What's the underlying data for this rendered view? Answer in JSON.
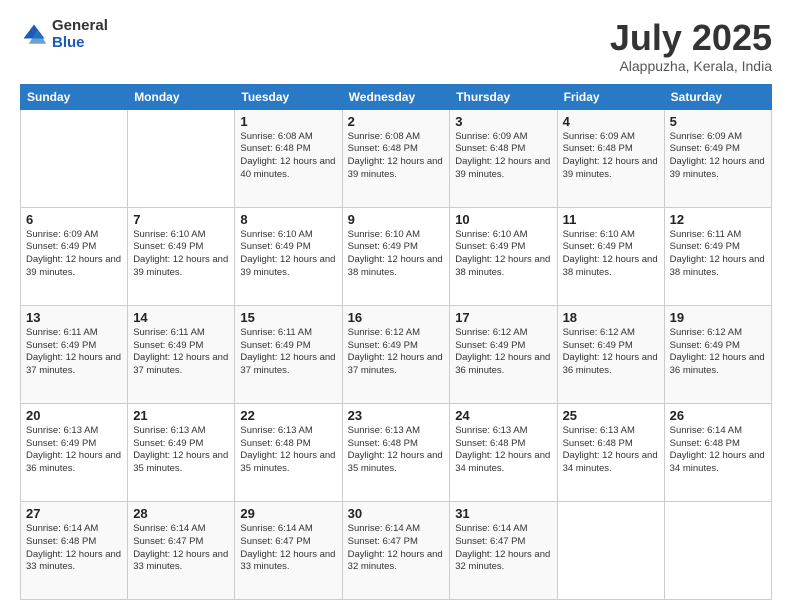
{
  "logo": {
    "general": "General",
    "blue": "Blue"
  },
  "header": {
    "month": "July 2025",
    "location": "Alappuzha, Kerala, India"
  },
  "weekdays": [
    "Sunday",
    "Monday",
    "Tuesday",
    "Wednesday",
    "Thursday",
    "Friday",
    "Saturday"
  ],
  "weeks": [
    [
      {
        "day": "",
        "info": ""
      },
      {
        "day": "",
        "info": ""
      },
      {
        "day": "1",
        "info": "Sunrise: 6:08 AM\nSunset: 6:48 PM\nDaylight: 12 hours and 40 minutes."
      },
      {
        "day": "2",
        "info": "Sunrise: 6:08 AM\nSunset: 6:48 PM\nDaylight: 12 hours and 39 minutes."
      },
      {
        "day": "3",
        "info": "Sunrise: 6:09 AM\nSunset: 6:48 PM\nDaylight: 12 hours and 39 minutes."
      },
      {
        "day": "4",
        "info": "Sunrise: 6:09 AM\nSunset: 6:48 PM\nDaylight: 12 hours and 39 minutes."
      },
      {
        "day": "5",
        "info": "Sunrise: 6:09 AM\nSunset: 6:49 PM\nDaylight: 12 hours and 39 minutes."
      }
    ],
    [
      {
        "day": "6",
        "info": "Sunrise: 6:09 AM\nSunset: 6:49 PM\nDaylight: 12 hours and 39 minutes."
      },
      {
        "day": "7",
        "info": "Sunrise: 6:10 AM\nSunset: 6:49 PM\nDaylight: 12 hours and 39 minutes."
      },
      {
        "day": "8",
        "info": "Sunrise: 6:10 AM\nSunset: 6:49 PM\nDaylight: 12 hours and 39 minutes."
      },
      {
        "day": "9",
        "info": "Sunrise: 6:10 AM\nSunset: 6:49 PM\nDaylight: 12 hours and 38 minutes."
      },
      {
        "day": "10",
        "info": "Sunrise: 6:10 AM\nSunset: 6:49 PM\nDaylight: 12 hours and 38 minutes."
      },
      {
        "day": "11",
        "info": "Sunrise: 6:10 AM\nSunset: 6:49 PM\nDaylight: 12 hours and 38 minutes."
      },
      {
        "day": "12",
        "info": "Sunrise: 6:11 AM\nSunset: 6:49 PM\nDaylight: 12 hours and 38 minutes."
      }
    ],
    [
      {
        "day": "13",
        "info": "Sunrise: 6:11 AM\nSunset: 6:49 PM\nDaylight: 12 hours and 37 minutes."
      },
      {
        "day": "14",
        "info": "Sunrise: 6:11 AM\nSunset: 6:49 PM\nDaylight: 12 hours and 37 minutes."
      },
      {
        "day": "15",
        "info": "Sunrise: 6:11 AM\nSunset: 6:49 PM\nDaylight: 12 hours and 37 minutes."
      },
      {
        "day": "16",
        "info": "Sunrise: 6:12 AM\nSunset: 6:49 PM\nDaylight: 12 hours and 37 minutes."
      },
      {
        "day": "17",
        "info": "Sunrise: 6:12 AM\nSunset: 6:49 PM\nDaylight: 12 hours and 36 minutes."
      },
      {
        "day": "18",
        "info": "Sunrise: 6:12 AM\nSunset: 6:49 PM\nDaylight: 12 hours and 36 minutes."
      },
      {
        "day": "19",
        "info": "Sunrise: 6:12 AM\nSunset: 6:49 PM\nDaylight: 12 hours and 36 minutes."
      }
    ],
    [
      {
        "day": "20",
        "info": "Sunrise: 6:13 AM\nSunset: 6:49 PM\nDaylight: 12 hours and 36 minutes."
      },
      {
        "day": "21",
        "info": "Sunrise: 6:13 AM\nSunset: 6:49 PM\nDaylight: 12 hours and 35 minutes."
      },
      {
        "day": "22",
        "info": "Sunrise: 6:13 AM\nSunset: 6:48 PM\nDaylight: 12 hours and 35 minutes."
      },
      {
        "day": "23",
        "info": "Sunrise: 6:13 AM\nSunset: 6:48 PM\nDaylight: 12 hours and 35 minutes."
      },
      {
        "day": "24",
        "info": "Sunrise: 6:13 AM\nSunset: 6:48 PM\nDaylight: 12 hours and 34 minutes."
      },
      {
        "day": "25",
        "info": "Sunrise: 6:13 AM\nSunset: 6:48 PM\nDaylight: 12 hours and 34 minutes."
      },
      {
        "day": "26",
        "info": "Sunrise: 6:14 AM\nSunset: 6:48 PM\nDaylight: 12 hours and 34 minutes."
      }
    ],
    [
      {
        "day": "27",
        "info": "Sunrise: 6:14 AM\nSunset: 6:48 PM\nDaylight: 12 hours and 33 minutes."
      },
      {
        "day": "28",
        "info": "Sunrise: 6:14 AM\nSunset: 6:47 PM\nDaylight: 12 hours and 33 minutes."
      },
      {
        "day": "29",
        "info": "Sunrise: 6:14 AM\nSunset: 6:47 PM\nDaylight: 12 hours and 33 minutes."
      },
      {
        "day": "30",
        "info": "Sunrise: 6:14 AM\nSunset: 6:47 PM\nDaylight: 12 hours and 32 minutes."
      },
      {
        "day": "31",
        "info": "Sunrise: 6:14 AM\nSunset: 6:47 PM\nDaylight: 12 hours and 32 minutes."
      },
      {
        "day": "",
        "info": ""
      },
      {
        "day": "",
        "info": ""
      }
    ]
  ]
}
